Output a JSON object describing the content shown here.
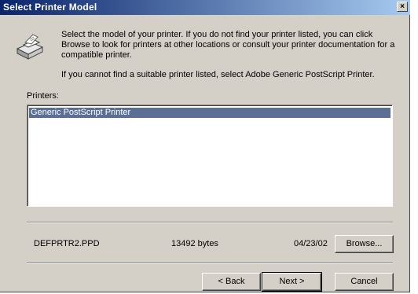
{
  "window": {
    "title": "Select Printer Model",
    "close_glyph": "×"
  },
  "instructions": {
    "primary": "Select the model of your printer. If you do not find your printer listed, you can click Browse to look for printers at other locations or consult your printer documentation for a compatible printer.",
    "secondary": "If you cannot find a suitable printer listed, select Adobe Generic PostScript Printer."
  },
  "printers": {
    "label": "Printers:",
    "items": [
      "Generic PostScript Printer"
    ],
    "selected_index": 0
  },
  "file_info": {
    "filename": "DEFPRTR2.PPD",
    "size": "13492 bytes",
    "date": "04/23/02"
  },
  "buttons": {
    "browse": "Browse...",
    "back": "< Back",
    "next": "Next >",
    "cancel": "Cancel"
  },
  "colors": {
    "title_start": "#0a246a",
    "title_end": "#a6caf0",
    "selection": "#5b6f96",
    "dialog_bg": "#d4d0c8"
  }
}
